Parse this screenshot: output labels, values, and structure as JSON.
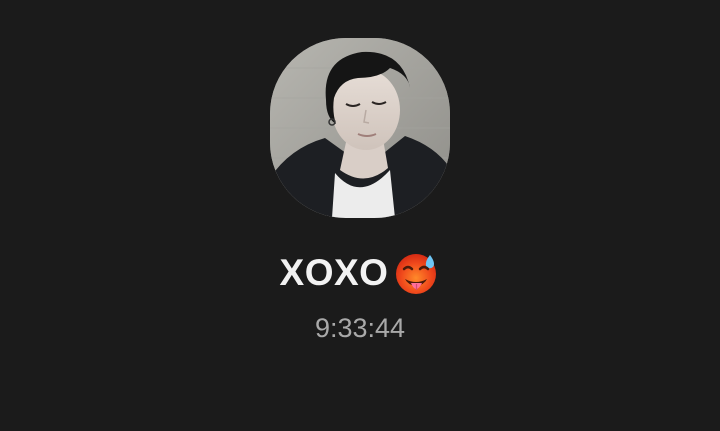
{
  "call": {
    "caller_name": "XOXO",
    "caller_emoji": "hot-face-emoji",
    "timer": "9:33:44"
  },
  "colors": {
    "background": "#1b1b1b",
    "name_text": "#f2f2f2",
    "timer_text": "#a9a9a9"
  },
  "avatar": {
    "icon": "contact-photo"
  }
}
